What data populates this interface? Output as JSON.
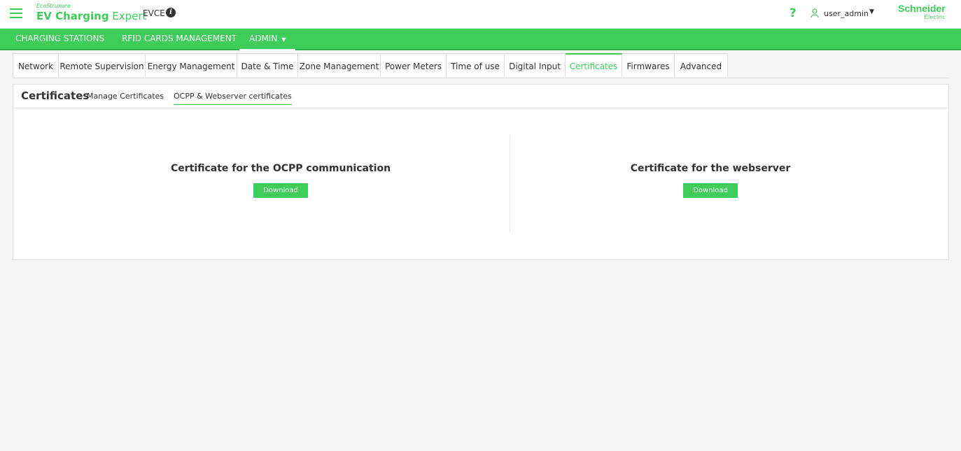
{
  "header": {
    "brand_top": "EcoStruxure",
    "brand_bold": "EV Charging",
    "brand_light": "Expert",
    "device": "EVCE",
    "help": "?",
    "user": "user_admin",
    "logo_line1": "Schneider",
    "logo_line2": "Electric"
  },
  "mainnav": {
    "items": [
      {
        "label": "CHARGING STATIONS"
      },
      {
        "label": "RFID CARDS MANAGEMENT"
      },
      {
        "label": "ADMIN"
      }
    ]
  },
  "subtabs": [
    {
      "label": "Network"
    },
    {
      "label": "Remote Supervision"
    },
    {
      "label": "Energy Management"
    },
    {
      "label": "Date & Time"
    },
    {
      "label": "Zone Management"
    },
    {
      "label": "Power Meters"
    },
    {
      "label": "Time of use"
    },
    {
      "label": "Digital Input"
    },
    {
      "label": "Certificates"
    },
    {
      "label": "Firmwares"
    },
    {
      "label": "Advanced"
    }
  ],
  "panel": {
    "title": "Certificates",
    "links": [
      {
        "label": "Manage Certificates"
      },
      {
        "label": "OCPP & Webserver certificates"
      }
    ],
    "left": {
      "title": "Certificate for the OCPP communication",
      "button": "Download"
    },
    "right": {
      "title": "Certificate for the webserver",
      "button": "Download"
    }
  },
  "colors": {
    "accent": "#3dcd58",
    "text": "#333333",
    "background": "#f5f5f5"
  }
}
